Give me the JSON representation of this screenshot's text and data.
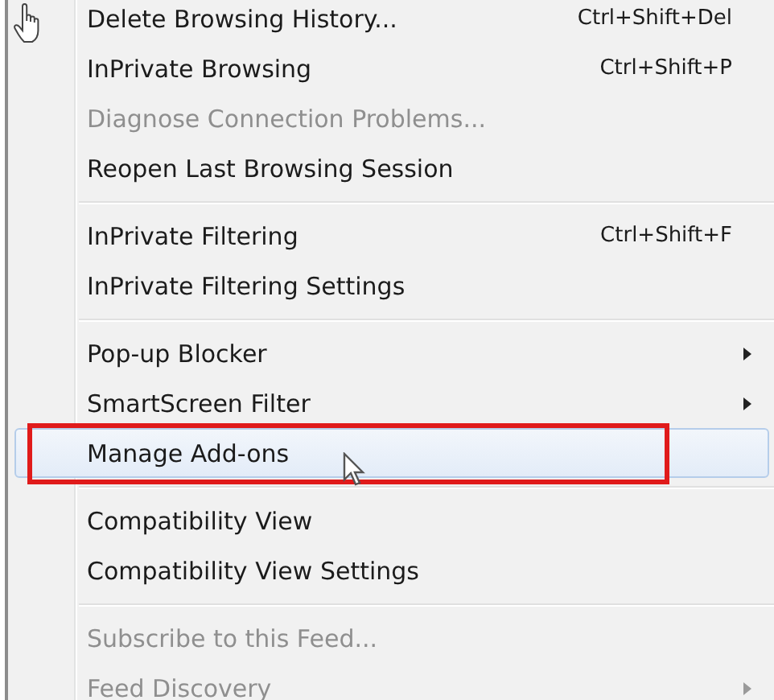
{
  "menu": {
    "groups": [
      {
        "items": [
          {
            "label": "Delete Browsing History...",
            "shortcut": "Ctrl+Shift+Del",
            "disabled": false,
            "submenu": false,
            "selected": false,
            "annotated": false
          },
          {
            "label": "InPrivate Browsing",
            "shortcut": "Ctrl+Shift+P",
            "disabled": false,
            "submenu": false,
            "selected": false,
            "annotated": false
          },
          {
            "label": "Diagnose Connection Problems...",
            "disabled": true,
            "submenu": false,
            "selected": false,
            "annotated": false
          },
          {
            "label": "Reopen Last Browsing Session",
            "disabled": false,
            "submenu": false,
            "selected": false,
            "annotated": false
          }
        ]
      },
      {
        "items": [
          {
            "label": "InPrivate Filtering",
            "shortcut": "Ctrl+Shift+F",
            "disabled": false,
            "submenu": false,
            "selected": false,
            "annotated": false
          },
          {
            "label": "InPrivate Filtering Settings",
            "disabled": false,
            "submenu": false,
            "selected": false,
            "annotated": false
          }
        ]
      },
      {
        "items": [
          {
            "label": "Pop-up Blocker",
            "disabled": false,
            "submenu": true,
            "selected": false,
            "annotated": false
          },
          {
            "label": "SmartScreen Filter",
            "disabled": false,
            "submenu": true,
            "selected": false,
            "annotated": false
          },
          {
            "label": "Manage Add-ons",
            "disabled": false,
            "submenu": false,
            "selected": true,
            "annotated": true
          }
        ]
      },
      {
        "items": [
          {
            "label": "Compatibility View",
            "disabled": false,
            "submenu": false,
            "selected": false,
            "annotated": false
          },
          {
            "label": "Compatibility View Settings",
            "disabled": false,
            "submenu": false,
            "selected": false,
            "annotated": false
          }
        ]
      },
      {
        "items": [
          {
            "label": "Subscribe to this Feed...",
            "disabled": true,
            "submenu": false,
            "selected": false,
            "annotated": false
          },
          {
            "label": "Feed Discovery",
            "disabled": true,
            "submenu": true,
            "selected": false,
            "annotated": false
          }
        ]
      }
    ]
  }
}
